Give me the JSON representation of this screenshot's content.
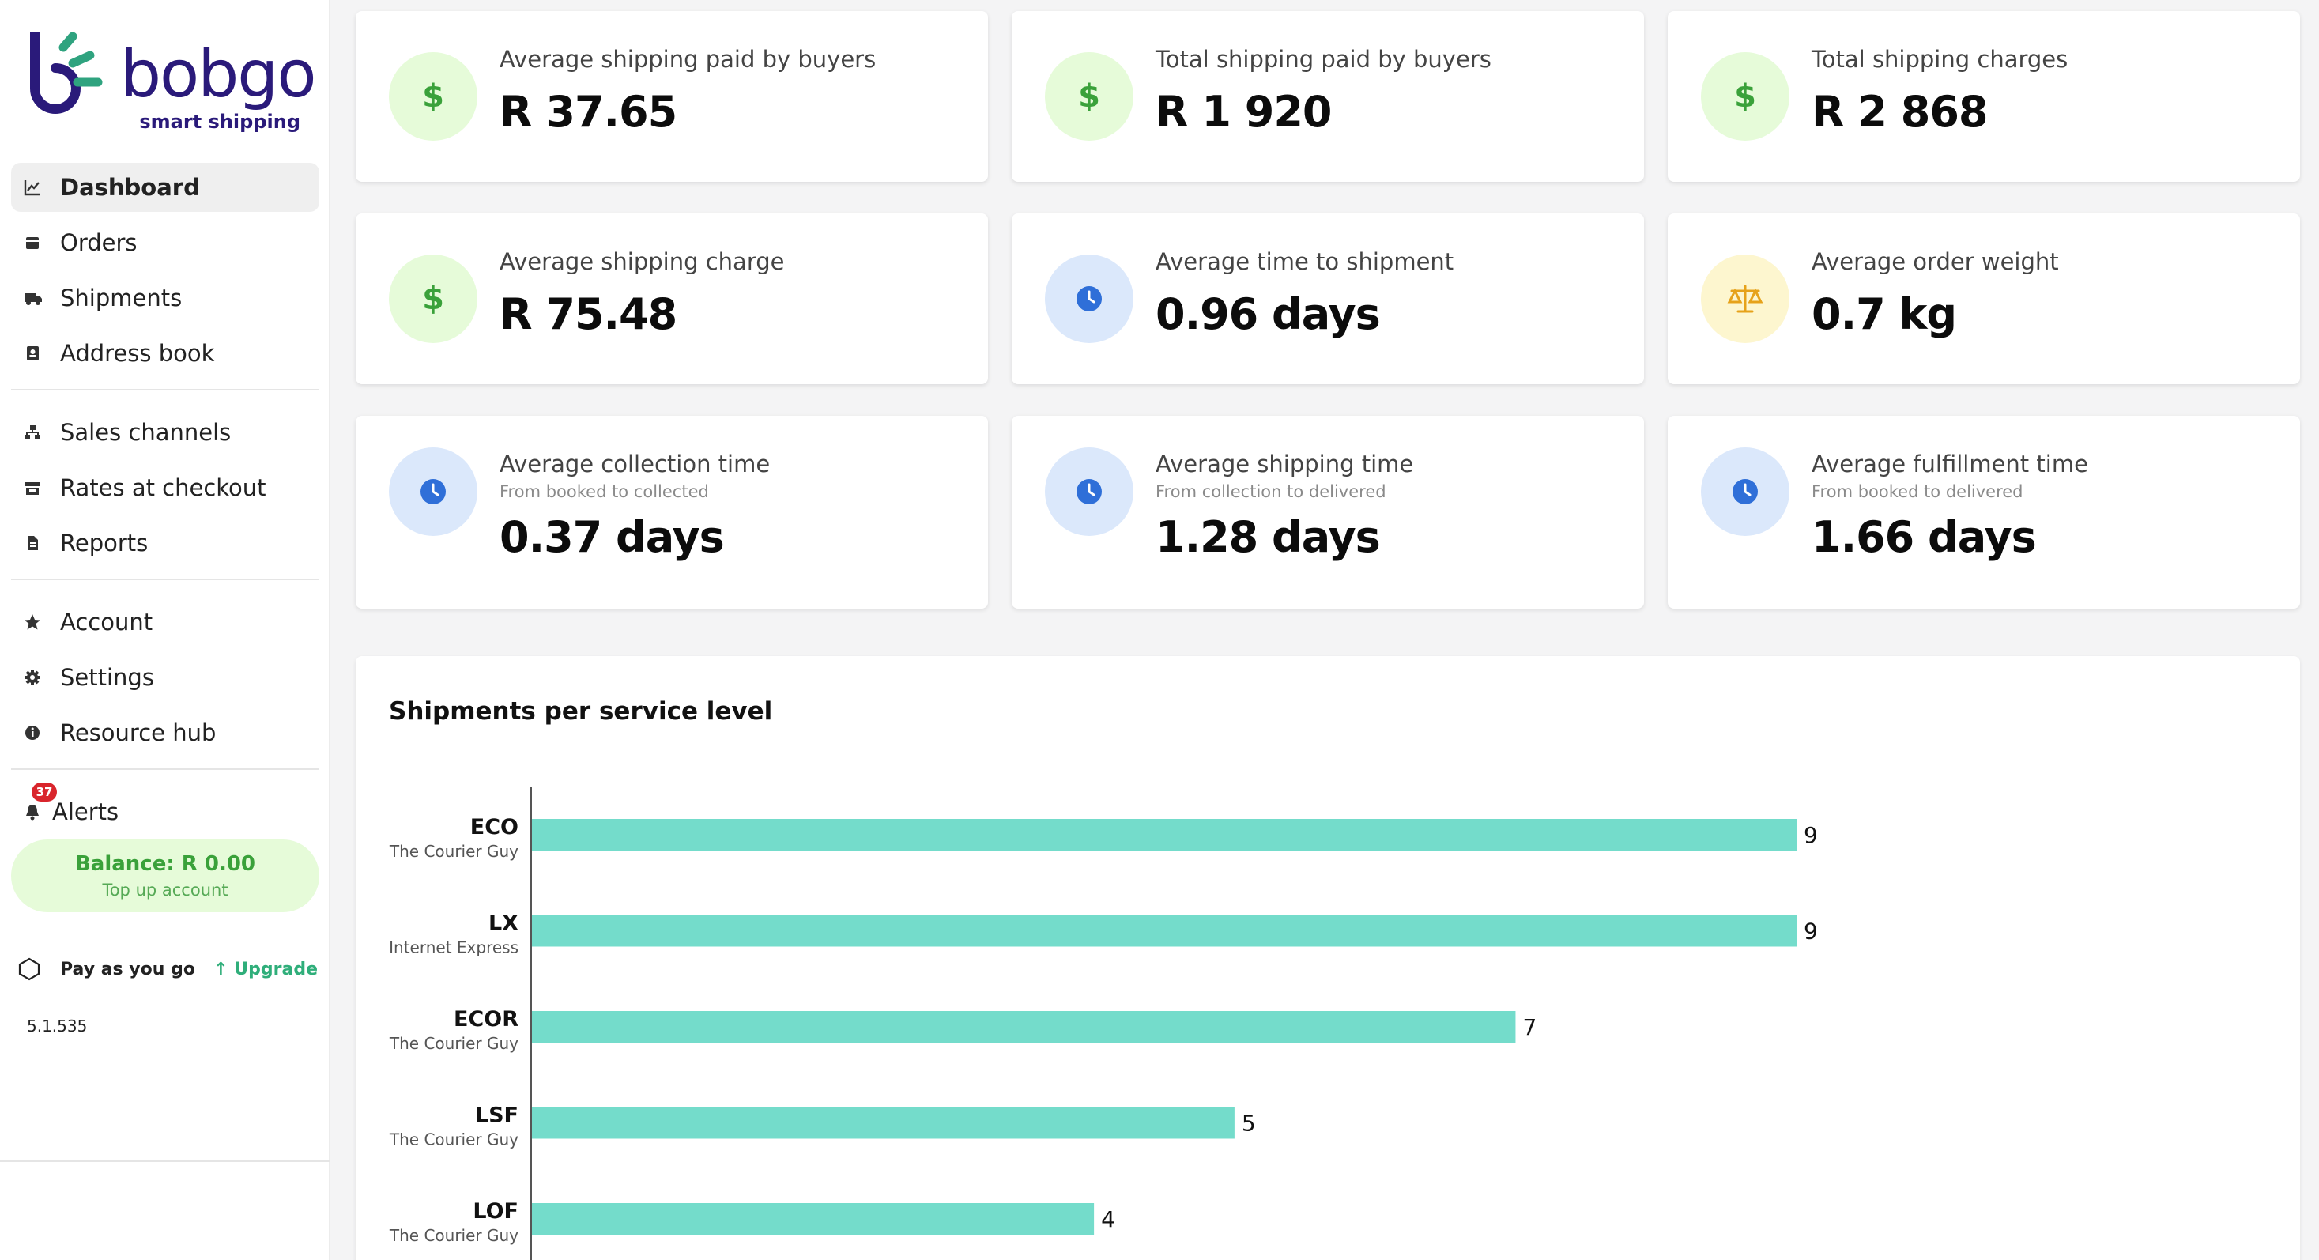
{
  "brand": {
    "name": "bobgo",
    "tagline": "smart shipping",
    "accent": "#2a1a7a",
    "mark_color": "#2fa37f"
  },
  "nav": {
    "group1": [
      {
        "label": "Dashboard",
        "icon": "chart-line-icon",
        "active": true
      },
      {
        "label": "Orders",
        "icon": "box-icon"
      },
      {
        "label": "Shipments",
        "icon": "truck-icon"
      },
      {
        "label": "Address book",
        "icon": "address-book-icon"
      }
    ],
    "group2": [
      {
        "label": "Sales channels",
        "icon": "sitemap-icon"
      },
      {
        "label": "Rates at checkout",
        "icon": "store-icon"
      },
      {
        "label": "Reports",
        "icon": "file-icon"
      }
    ],
    "group3": [
      {
        "label": "Account",
        "icon": "star-icon"
      },
      {
        "label": "Settings",
        "icon": "gear-icon"
      },
      {
        "label": "Resource hub",
        "icon": "info-icon"
      }
    ],
    "alerts": {
      "label": "Alerts",
      "count": "37"
    }
  },
  "balance": {
    "title": "Balance: R 0.00",
    "subtitle": "Top up account"
  },
  "plan": {
    "name": "Pay as you go",
    "upgrade": "Upgrade"
  },
  "version": "5.1.535",
  "stats": [
    {
      "label": "Average shipping paid by buyers",
      "value": "R 37.65",
      "icon": "dollar-icon",
      "tone": "green"
    },
    {
      "label": "Total shipping paid by buyers",
      "value": "R 1 920",
      "icon": "dollar-icon",
      "tone": "green"
    },
    {
      "label": "Total shipping charges",
      "value": "R 2 868",
      "icon": "dollar-icon",
      "tone": "green"
    },
    {
      "label": "Average shipping charge",
      "value": "R 75.48",
      "icon": "dollar-icon",
      "tone": "green"
    },
    {
      "label": "Average time to shipment",
      "value": "0.96 days",
      "icon": "clock-icon",
      "tone": "blue"
    },
    {
      "label": "Average order weight",
      "value": "0.7 kg",
      "icon": "scale-icon",
      "tone": "yellow"
    },
    {
      "label": "Average collection time",
      "sub": "From booked to collected",
      "value": "0.37 days",
      "icon": "clock-icon",
      "tone": "blue"
    },
    {
      "label": "Average shipping time",
      "sub": "From collection to delivered",
      "value": "1.28 days",
      "icon": "clock-icon",
      "tone": "blue"
    },
    {
      "label": "Average fulfillment time",
      "sub": "From booked to delivered",
      "value": "1.66 days",
      "icon": "clock-icon",
      "tone": "blue"
    }
  ],
  "chart_data": {
    "type": "bar",
    "orientation": "horizontal",
    "title": "Shipments per service level",
    "categories": [
      "ECO",
      "LX",
      "ECOR",
      "LSF",
      "LOF"
    ],
    "subcategories": [
      "The Courier Guy",
      "Internet Express",
      "The Courier Guy",
      "The Courier Guy",
      "The Courier Guy"
    ],
    "values": [
      9,
      9,
      7,
      5,
      4
    ],
    "xlim": [
      0,
      9
    ],
    "grid": false,
    "bar_color": "#74dccb"
  }
}
